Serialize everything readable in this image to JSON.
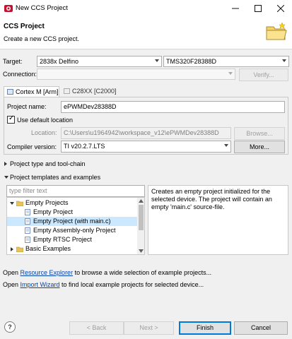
{
  "window": {
    "title": "New CCS Project"
  },
  "header": {
    "title": "CCS Project",
    "subtitle": "Create a new CCS project."
  },
  "target": {
    "label": "Target:",
    "family": "2838x Delfino",
    "device": "TMS320F28388D"
  },
  "connection": {
    "label": "Connection:",
    "value": "",
    "verify_label": "Verify..."
  },
  "tabs": [
    {
      "label": "Cortex M [Arm]"
    },
    {
      "label": "C28XX [C2000]"
    }
  ],
  "project": {
    "name_label": "Project name:",
    "name_value": "ePWMDev28388D",
    "use_default_label": "Use default location",
    "use_default_checked": true,
    "location_label": "Location:",
    "location_value": "C:\\Users\\u1964942\\workspace_v12\\ePWMDev28388D",
    "browse_label": "Browse...",
    "compiler_label": "Compiler version:",
    "compiler_value": "TI v20.2.7.LTS",
    "more_label": "More..."
  },
  "sections": {
    "type_toolchain": "Project type and tool-chain",
    "templates": "Project templates and examples"
  },
  "filter": {
    "placeholder": "type filter text"
  },
  "tree": {
    "group": "Empty Projects",
    "items": [
      "Empty Project",
      "Empty Project (with main.c)",
      "Empty Assembly-only Project",
      "Empty RTSC Project"
    ],
    "selected_index": 1,
    "next_group": "Basic Examples"
  },
  "description": "Creates an empty project initialized for the selected device. The project will contain an empty 'main.c' source-file.",
  "footer_links": {
    "line1_prefix": "Open ",
    "line1_link": "Resource Explorer",
    "line1_suffix": " to browse a wide selection of example projects...",
    "line2_prefix": "Open ",
    "line2_link": "Import Wizard",
    "line2_suffix": " to find local example projects for selected device..."
  },
  "buttons": {
    "help": "?",
    "back": "< Back",
    "next": "Next >",
    "finish": "Finish",
    "cancel": "Cancel"
  },
  "colors": {
    "accent": "#0078d7",
    "link": "#0645ad",
    "selection": "#cce8ff",
    "app_icon": "#c8102e"
  }
}
